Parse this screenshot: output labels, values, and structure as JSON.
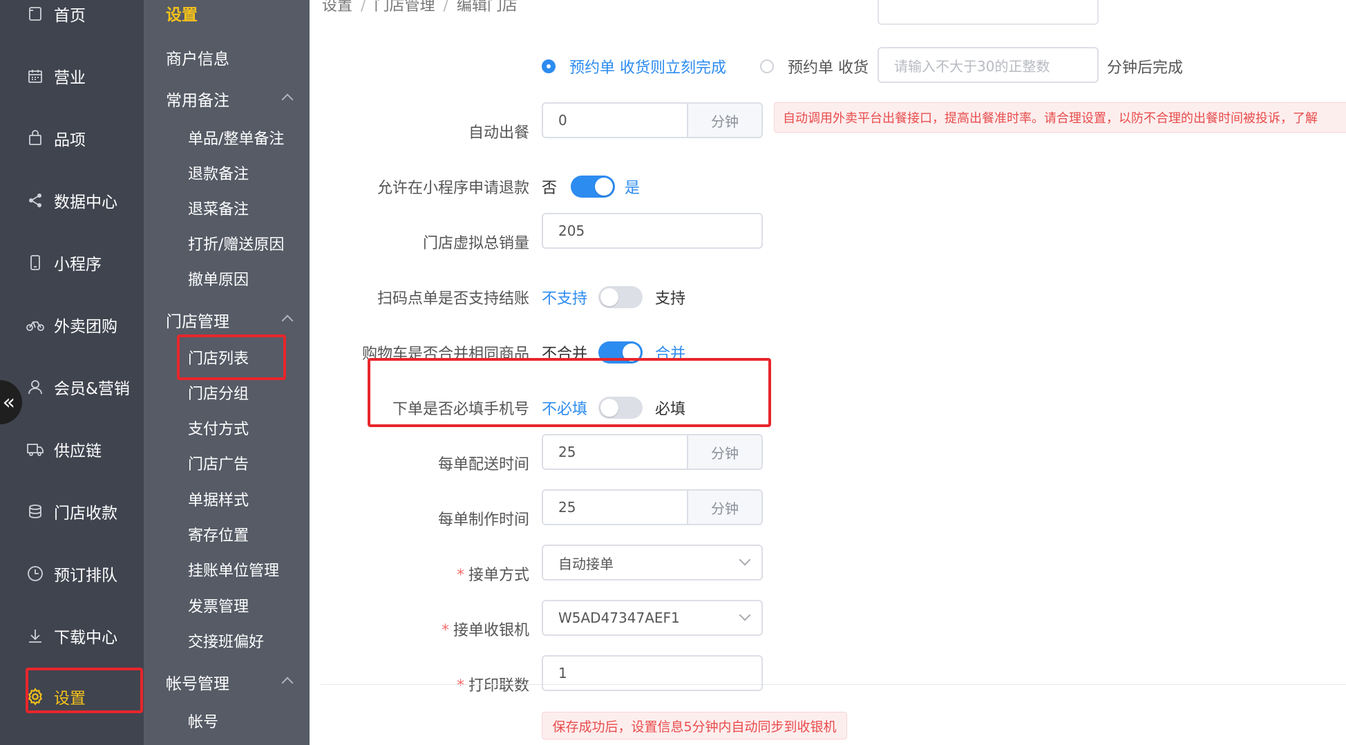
{
  "nav_primary": {
    "items": [
      {
        "label": "首页",
        "icon": "home-icon"
      },
      {
        "label": "营业",
        "icon": "calendar-icon"
      },
      {
        "label": "品项",
        "icon": "bag-icon"
      },
      {
        "label": "数据中心",
        "icon": "share-icon"
      },
      {
        "label": "小程序",
        "icon": "phone-icon"
      },
      {
        "label": "外卖团购",
        "icon": "bike-icon"
      },
      {
        "label": "会员&营销",
        "icon": "user-icon"
      },
      {
        "label": "供应链",
        "icon": "truck-icon"
      },
      {
        "label": "门店收款",
        "icon": "coins-icon"
      },
      {
        "label": "预订排队",
        "icon": "clock-icon"
      },
      {
        "label": "下载中心",
        "icon": "download-icon"
      },
      {
        "label": "设置",
        "icon": "gear-icon"
      }
    ],
    "collapse_glyph": "«"
  },
  "nav_secondary": {
    "title": "设置",
    "merchant_info": "商户信息",
    "group_remarks": {
      "label": "常用备注",
      "items": [
        "单品/整单备注",
        "退款备注",
        "退菜备注",
        "打折/赠送原因",
        "撤单原因"
      ]
    },
    "group_store": {
      "label": "门店管理",
      "items": [
        "门店列表",
        "门店分组",
        "支付方式",
        "门店广告",
        "单据样式",
        "寄存位置",
        "挂账单位管理",
        "发票管理",
        "交接班偏好"
      ]
    },
    "group_account": {
      "label": "帐号管理",
      "items": [
        "帐号"
      ]
    }
  },
  "breadcrumb": [
    "设置",
    "门店管理",
    "编辑门店"
  ],
  "form": {
    "preorder": {
      "option1": "预约单 收货则立刻完成",
      "option2": "预约单 收货",
      "input_placeholder": "请输入不大于30的正整数",
      "suffix": "分钟后完成"
    },
    "auto_meal": {
      "label": "自动出餐",
      "value": "0",
      "unit": "分钟",
      "alert": "自动调用外卖平台出餐接口，提高出餐准时率。请合理设置，以防不合理的出餐时间被投诉，了解"
    },
    "refund_miniapp": {
      "label": "允许在小程序申请退款",
      "off_text": "否",
      "on_text": "是",
      "on": true
    },
    "virtual_sales": {
      "label": "门店虚拟总销量",
      "value": "205"
    },
    "scan_checkout": {
      "label": "扫码点单是否支持结账",
      "off_text": "不支持",
      "on_text": "支持",
      "on": false
    },
    "merge_cart": {
      "label": "购物车是否合并相同商品",
      "off_text": "不合并",
      "on_text": "合并",
      "on": true
    },
    "phone_required": {
      "label": "下单是否必填手机号",
      "off_text": "不必填",
      "on_text": "必填",
      "on": false
    },
    "delivery_time": {
      "label": "每单配送时间",
      "value": "25",
      "unit": "分钟"
    },
    "prep_time": {
      "label": "每单制作时间",
      "value": "25",
      "unit": "分钟"
    },
    "accept_mode": {
      "label": "接单方式",
      "value": "自动接单",
      "required": "*"
    },
    "accept_cashier": {
      "label": "接单收银机",
      "value": "W5AD47347AEF1",
      "required": "*"
    },
    "print_copies": {
      "label": "打印联数",
      "value": "1",
      "required": "*"
    }
  },
  "footer_notice": "保存成功后，设置信息5分钟内自动同步到收银机",
  "colors": {
    "accent": "#2d8cf0",
    "highlight": "#f5c21b",
    "danger": "#e8262b"
  }
}
